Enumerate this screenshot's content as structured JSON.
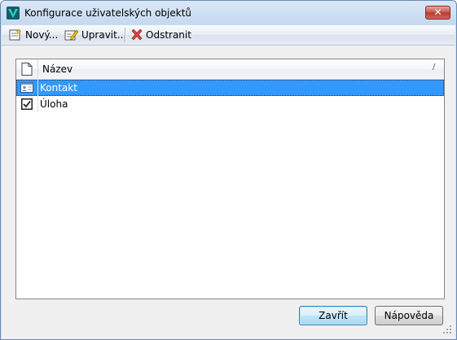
{
  "window": {
    "title": "Konfigurace uživatelských objektů",
    "close_glyph": "✕"
  },
  "toolbar": {
    "new_label": "Nový...",
    "edit_label": "Upravit...",
    "delete_label": "Odstranit"
  },
  "list": {
    "column_name": "Název",
    "sort_glyph": "/",
    "rows": [
      {
        "label": "Kontakt",
        "icon": "contact-card-icon",
        "selected": true
      },
      {
        "label": "Úloha",
        "icon": "task-checkbox-icon",
        "selected": false
      }
    ]
  },
  "buttons": {
    "close_label": "Zavřít",
    "help_label": "Nápověda"
  },
  "colors": {
    "selection": "#3399ff",
    "title_bar": "#c6d9f0",
    "accent_icon": "#1aa9a4"
  }
}
